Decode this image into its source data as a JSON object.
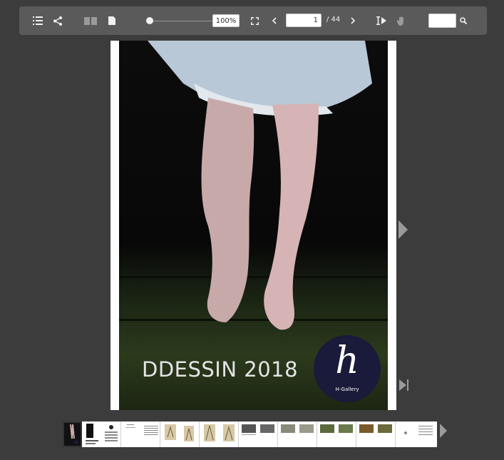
{
  "toolbar": {
    "zoom": "100%",
    "current_page": "1",
    "page_total": "/ 44",
    "search_value": ""
  },
  "cover": {
    "title": "DDESSIN 2018",
    "logo_letter": "h",
    "logo_name": "H-Gallery"
  }
}
